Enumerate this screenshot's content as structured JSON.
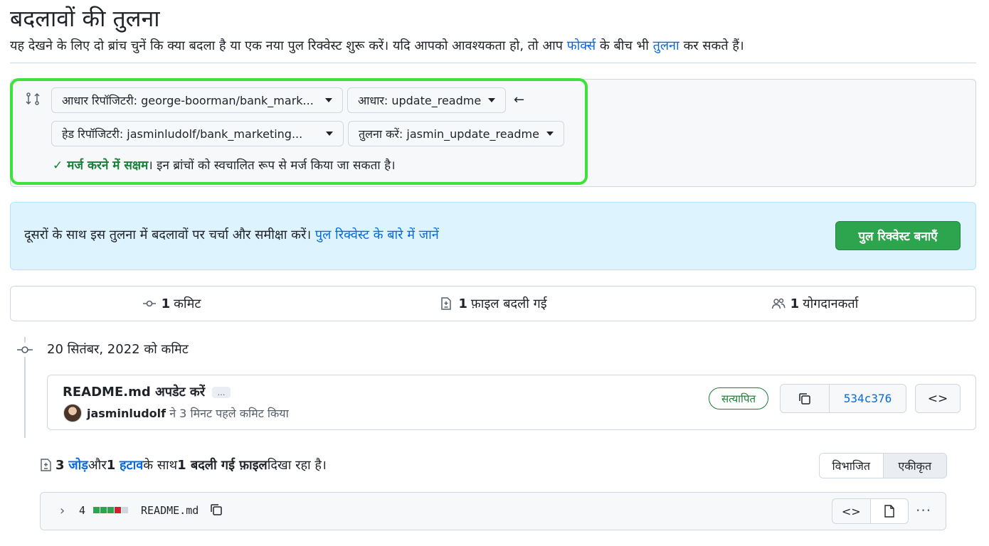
{
  "page": {
    "title": "बदलावों की तुलना",
    "subtitle_pre": "यह देखने के लिए दो ब्रांच चुनें कि क्या बदला है या एक नया पुल रिक्वेस्ट शुरू करें। यदि आपको आवश्यकता हो, तो आप ",
    "subtitle_link1": "फोर्क्स",
    "subtitle_mid": " के बीच भी ",
    "subtitle_link2": "तुलना",
    "subtitle_post": " कर सकते हैं।"
  },
  "compare": {
    "base_repo": "आधार रिपॉजिटरी: george-boorman/bank_mark...",
    "base_branch": "आधार: update_readme",
    "head_repo": "हेड रिपॉजिटरी: jasminludolf/bank_marketing...",
    "compare_branch": "तुलना करें: jasmin_update_readme",
    "merge_ok": "मर्ज करने में सक्षम",
    "merge_rest": "। इन ब्रांचों को स्वचालित रूप से मर्ज किया जा सकता है।"
  },
  "banner": {
    "text": "दूसरों के साथ इस तुलना में बदलावों पर चर्चा और समीक्षा करें। ",
    "link": "पुल रिक्वेस्ट के बारे में जानें",
    "button": "पुल रिक्वेस्ट बनाएँ"
  },
  "stats": {
    "commits_count": "1",
    "commits_label": "कमिट",
    "files_count": "1",
    "files_label": "फ़ाइल बदली गई",
    "contributors_count": "1",
    "contributors_label": "योगदानकर्ता"
  },
  "commit": {
    "date_label": "20 सितंबर, 2022 को कमिट",
    "message": "README.md अपडेट करें",
    "ellipsis": "…",
    "author": "jasminludolf",
    "author_rest": " ने 3 मिनट पहले कमिट किया",
    "verified": "सत्यापित",
    "sha": "534c376",
    "browse": "<>"
  },
  "summary": {
    "additions_count": "3",
    "additions_label": "जोड़",
    "and": " और ",
    "deletions_count": "1",
    "deletions_label": "हटाव",
    "with": " के साथ ",
    "files_changed": "1 बदली गई फ़ाइल",
    "showing": " दिखा रहा है।",
    "split": "विभाजित",
    "unified": "एकीकृत"
  },
  "file": {
    "changes": "4",
    "name": "README.md",
    "diffstat": [
      "add",
      "add",
      "add",
      "del",
      "neutral"
    ],
    "view_code": "<>",
    "more": "···"
  },
  "colors": {
    "add": "#2da44e",
    "del": "#cf222e",
    "neutral": "#d0d7de",
    "highlight": "#3fe23a"
  }
}
